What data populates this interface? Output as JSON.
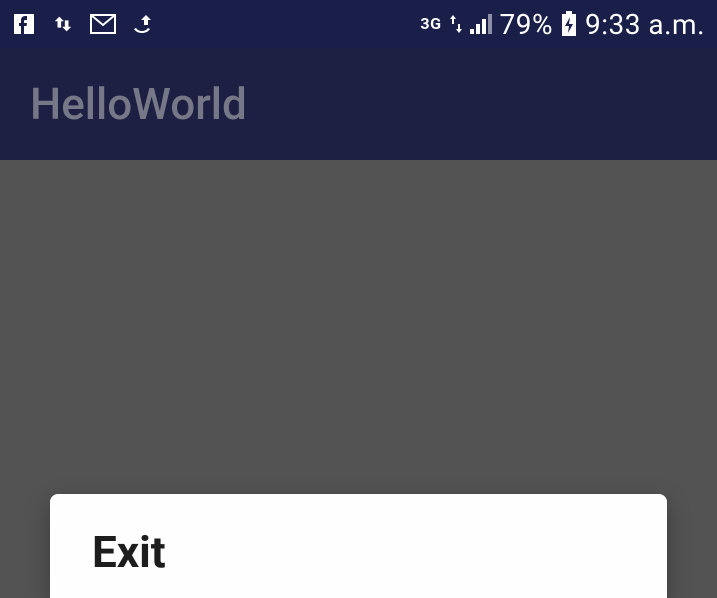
{
  "status": {
    "network_label": "3G",
    "battery_pct": "79%",
    "time": "9:33 a.m."
  },
  "app_bar": {
    "title": "HelloWorld"
  },
  "dialog": {
    "title": "Exit"
  }
}
